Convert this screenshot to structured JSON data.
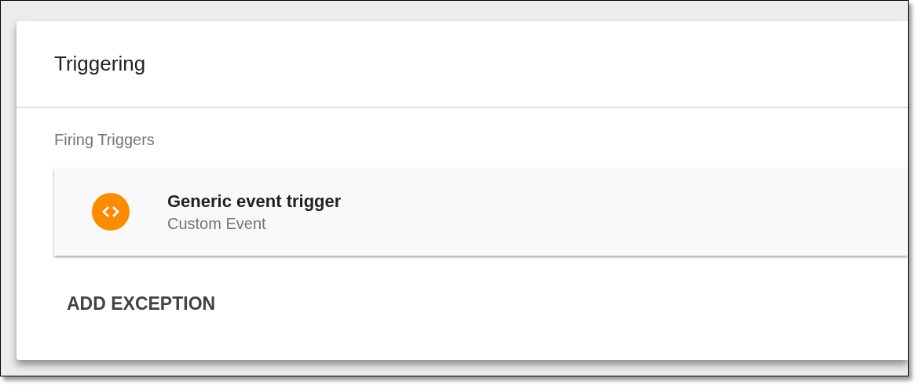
{
  "card": {
    "title": "Triggering"
  },
  "section": {
    "label": "Firing Triggers"
  },
  "triggers": [
    {
      "name": "Generic event trigger",
      "type": "Custom Event",
      "kind": "custom_event"
    }
  ],
  "actions": [
    {
      "label": "ADD EXCEPTION"
    }
  ]
}
